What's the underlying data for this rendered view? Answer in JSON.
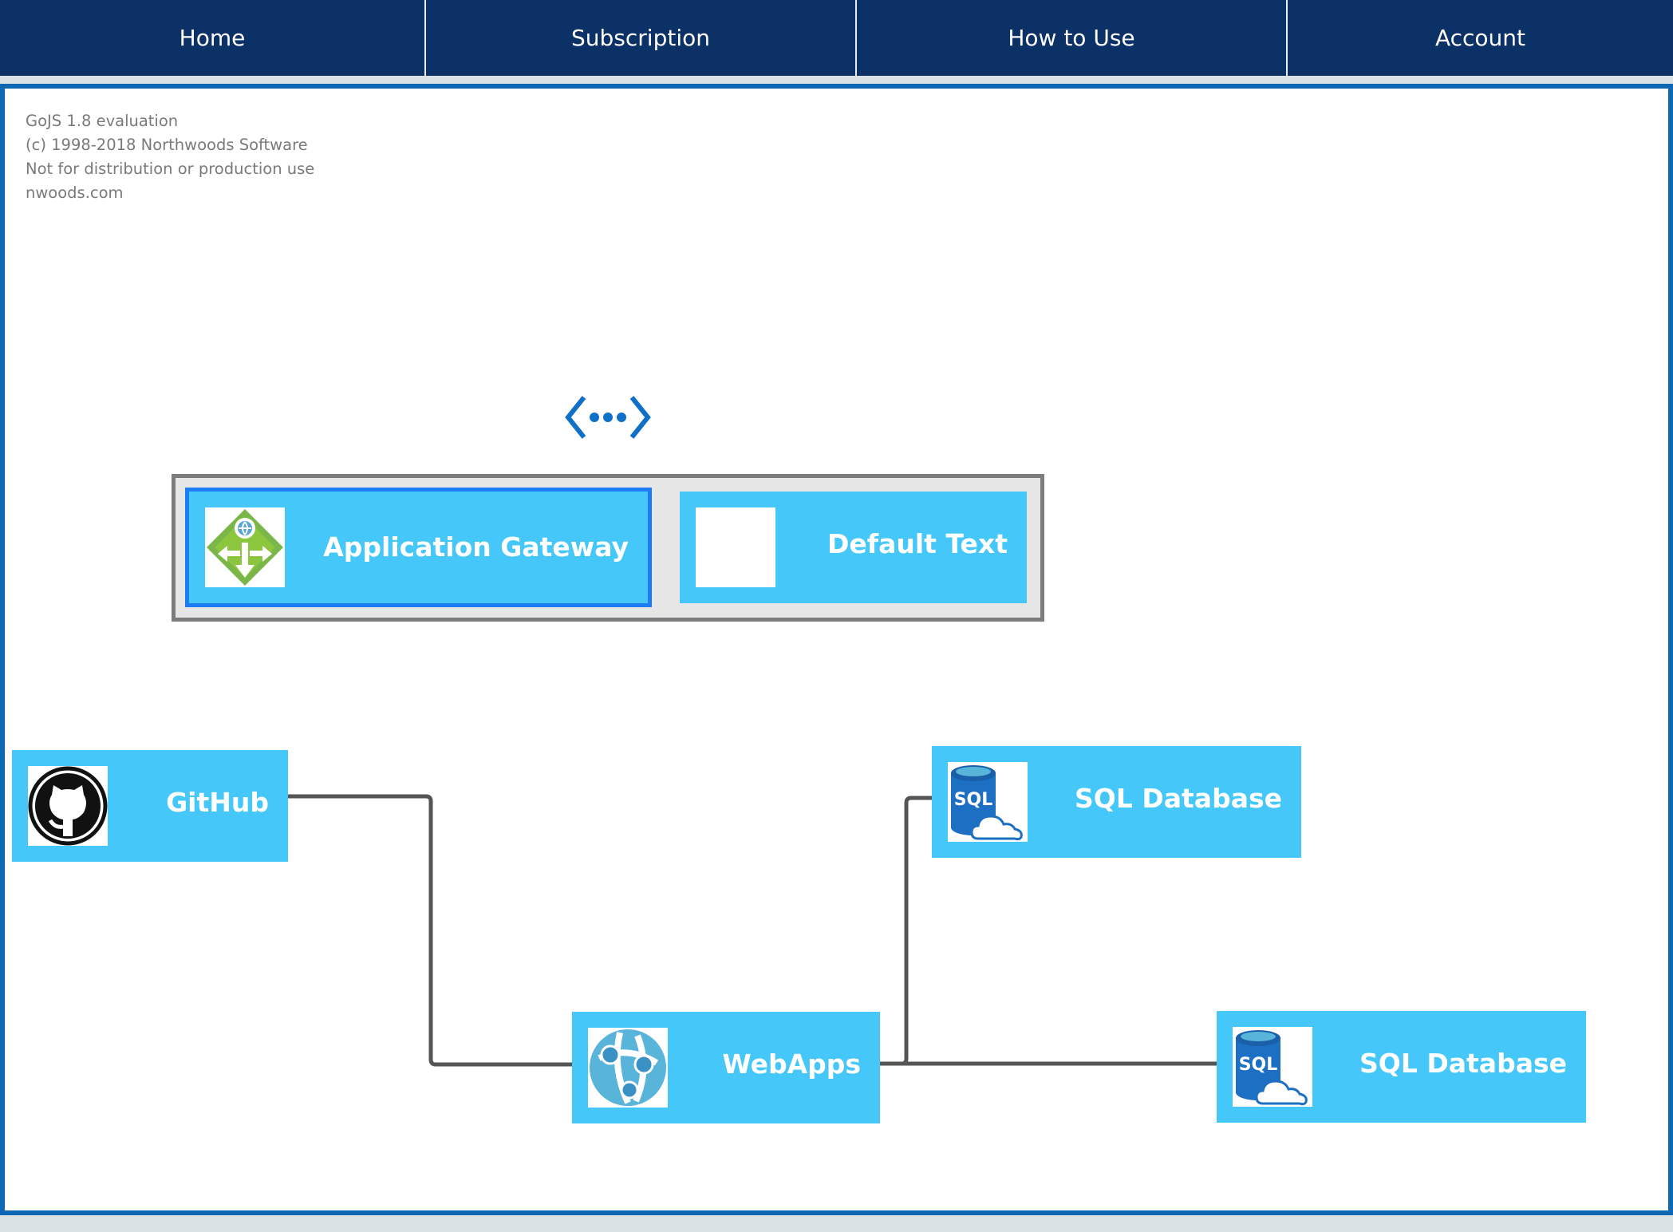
{
  "nav": {
    "items": [
      {
        "label": "Home"
      },
      {
        "label": "Subscription"
      },
      {
        "label": "How to Use"
      },
      {
        "label": "Account"
      }
    ]
  },
  "watermark": {
    "lines": [
      "GoJS 1.8 evaluation",
      "(c) 1998-2018 Northwoods Software",
      "Not for distribution or production use",
      "nwoods.com"
    ]
  },
  "diagram": {
    "group": {
      "icon": "vnet-icon",
      "nodes": [
        {
          "label": "Application Gateway",
          "icon": "application-gateway-icon",
          "selected": true
        },
        {
          "label": "Default Text",
          "icon": "blank-icon",
          "selected": false
        }
      ]
    },
    "nodes": {
      "github": {
        "label": "GitHub",
        "icon": "github-icon"
      },
      "webapps": {
        "label": "WebApps",
        "icon": "webapps-icon"
      },
      "sql1": {
        "label": "SQL Database",
        "icon": "sql-database-icon",
        "icon_text": "SQL"
      },
      "sql2": {
        "label": "SQL Database",
        "icon": "sql-database-icon",
        "icon_text": "SQL"
      }
    },
    "links": [
      {
        "from": "GitHub",
        "to": "WebApps"
      },
      {
        "from": "WebApps",
        "to": "SQL Database"
      },
      {
        "from": "WebApps",
        "to": "SQL Database"
      }
    ],
    "colors": {
      "nav_bg": "#0c3166",
      "frame_border": "#0d68b3",
      "node_fill": "#45c8f9",
      "selection": "#1c7cf4",
      "group_fill": "#e6e6e6",
      "group_border": "#7c7c7c",
      "link": "#555555"
    }
  }
}
